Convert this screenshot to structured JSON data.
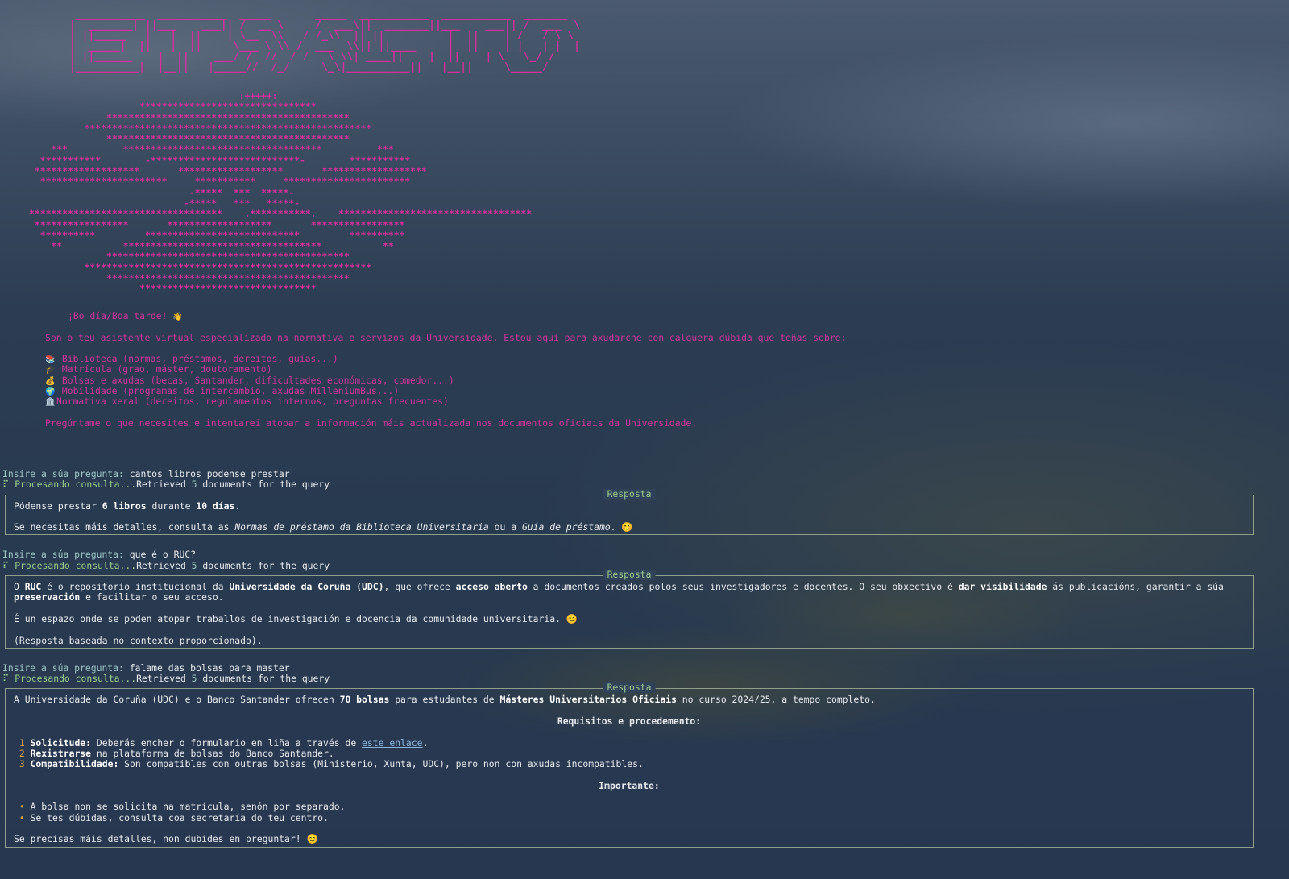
{
  "colors": {
    "accent": "#d0339a",
    "prompt": "#9fc7c6",
    "processing": "#9ccf8c",
    "panel_border": "#8f9f8a"
  },
  "logo_ascii": " ___________  ___________  _____       _____  ___________  ___________  _______ \n|  _______| ||___    ___|| /  __ \\     /  ___\\||  _______||___    ___|| /  ___  \\\n| ||_____   |   |  ||    | \\__  \\\\   / /_\\\\  || ||          |  ||    | /   / \\ \\\n|  _____|  ||   |  ||     \\___ \\ \\\\ /  ___  \\\\|| ||____     |  ||    | |   | |  |\n| ||______    |  ||    ___/ /  //  / /   \\ \\\\| ____||    |  ||    | \\   \\_/ / \n|__________|  |__||   |_____//  /_/     \\_\\|__________||   |__||     \\_____/  ",
  "planet_ascii": "                                      :+++++:\n                    ********************************\n              ********************************************\n          ****************************************************\n              ********************************************\n    ***          ************************************          ***\n  ***********        -***************************-        ***********\n *******************       *******************       *******************\n  ***********************     ***********     ***********************\n                             -*****  ***  *****-\n                            -*****   ***   *****-\n***********************************    .***********.    ***********************************\n *****************       *******************       *****************\n  **********         ****************************         **********\n    **           ************************************           **\n              ********************************************\n          ****************************************************\n              ********************************************\n                    ********************************",
  "intro": {
    "greeting": "¡Bo día/Boa tarde! ",
    "greeting_emoji": "👋",
    "description": "Son o teu asistente virtual especializado na normativa e servizos da Universidade. Estou aquí para axudarche con calquera dúbida que teñas sobre:",
    "topics": [
      {
        "icon": "📚",
        "text": " Biblioteca (normas, préstamos, dereitos, guías...)"
      },
      {
        "icon": "🎓",
        "text": " Matrícula (grao, máster, doutoramento)"
      },
      {
        "icon": "💰",
        "text": " Bolsas e axudas (becas, Santander, dificultades económicas, comedor...)"
      },
      {
        "icon": "🌍",
        "text": " Mobilidade (programas de intercambio, axudas MilleniumBus...)"
      },
      {
        "icon": "🏛️",
        "text": "Normativa xeral (dereitos, regulamentos internos, preguntas frecuentes)"
      }
    ],
    "closing": "Pregúntame o que necesites e intentarei atopar a información máis actualizada nos documentos oficiais da Universidade."
  },
  "prompt_label": "Insire a súa pregunta:",
  "processing_label": "Procesando consulta...",
  "retrieved_prefix": "Retrieved ",
  "retrieved_count": "5",
  "retrieved_suffix": " documents for the query",
  "panel_title": "Resposta",
  "conversation": [
    {
      "question": " cantos libros podense prestar",
      "answer": {
        "l1_a": "Pódense prestar ",
        "l1_b": "6 libros",
        "l1_c": " durante ",
        "l1_d": "10 días",
        "l1_e": ".",
        "l2_a": "Se necesitas máis detalles, consulta as ",
        "l2_b": "Normas de préstamo da Biblioteca Universitaria",
        "l2_c": " ou a ",
        "l2_d": "Guía de préstamo",
        "l2_e": ". 😊"
      }
    },
    {
      "question": " que é o RUC?",
      "answer": {
        "l1_a": "O ",
        "l1_b": "RUC",
        "l1_c": " é o repositorio institucional da ",
        "l1_d": "Universidade da Coruña (UDC)",
        "l1_e": ", que ofrece ",
        "l1_f": "acceso aberto",
        "l1_g": " a documentos creados polos seus investigadores e docentes. O seu obxectivo é ",
        "l1_h": "dar visibilidade",
        "l1_i": " ás publicacións, garantir a súa ",
        "l1_j": "preservación",
        "l1_k": " e facilitar o seu acceso.",
        "l2": "É un espazo onde se poden atopar traballos de investigación e docencia da comunidade universitaria. 😊",
        "l3": "(Resposta baseada no contexto proporcionado)."
      }
    },
    {
      "question": " falame das bolsas para master",
      "answer": {
        "l1_a": "A Universidade da Coruña (UDC) e o Banco Santander ofrecen ",
        "l1_b": "70 bolsas",
        "l1_c": " para estudantes de ",
        "l1_d": "Másteres Universitarios Oficiais",
        "l1_e": " no curso 2024/25, a tempo completo.",
        "heading1": "Requisitos e procedemento:",
        "steps": [
          {
            "n": "1",
            "title": "Solicitude:",
            "text": " Deberás encher o formulario en liña a través de ",
            "link": "este enlace",
            "end": "."
          },
          {
            "n": "2",
            "title": "Rexistrarse",
            "text": " na plataforma de bolsas do Banco Santander.",
            "link": "",
            "end": ""
          },
          {
            "n": "3",
            "title": "Compatibilidade:",
            "text": " Son compatibles con outras bolsas (Ministerio, Xunta, UDC), pero non con axudas incompatibles.",
            "link": "",
            "end": ""
          }
        ],
        "heading2": "Importante:",
        "bullets": [
          "A bolsa non se solicita na matrícula, senón por separado.",
          "Se tes dúbidas, consulta coa secretaría do teu centro."
        ],
        "closing": "Se precisas máis detalles, non dubides en preguntar! 😊"
      }
    }
  ]
}
